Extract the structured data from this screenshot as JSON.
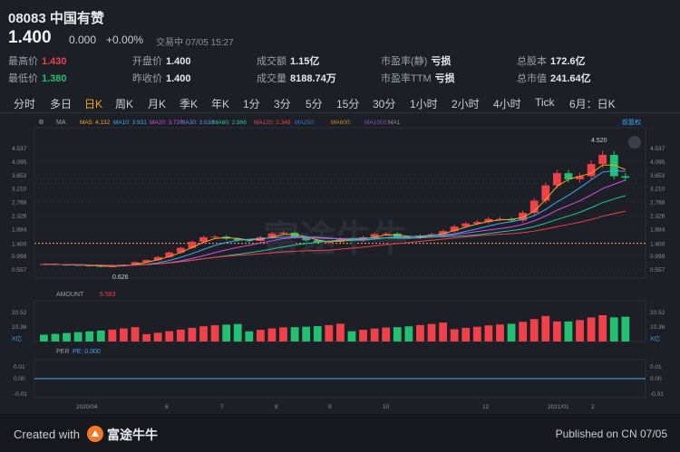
{
  "header": {
    "code_name": "08083 中国有赞",
    "price": "1.400",
    "change": "0.000",
    "change_pct": "+0.00%",
    "status": "交易中 07/05 15:27",
    "stats": [
      {
        "key": "最高价",
        "value": "1.430",
        "tone": "up"
      },
      {
        "key": "开盘价",
        "value": "1.400",
        "tone": ""
      },
      {
        "key": "成交额",
        "value": "1.15亿",
        "tone": ""
      },
      {
        "key": "市盈率(静)",
        "value": "亏损",
        "tone": ""
      },
      {
        "key": "总股本",
        "value": "172.6亿",
        "tone": ""
      },
      {
        "key": "最低价",
        "value": "1.380",
        "tone": "dn"
      },
      {
        "key": "昨收价",
        "value": "1.400",
        "tone": ""
      },
      {
        "key": "成交量",
        "value": "8188.74万",
        "tone": ""
      },
      {
        "key": "市盈率TTM",
        "value": "亏损",
        "tone": ""
      },
      {
        "key": "总市值",
        "value": "241.64亿",
        "tone": ""
      }
    ]
  },
  "tabs": [
    "分时",
    "多日",
    "日K",
    "周K",
    "月K",
    "季K",
    "年K",
    "1分",
    "3分",
    "5分",
    "15分",
    "30分",
    "1小时",
    "2小时",
    "4小时",
    "Tick",
    "6月：日K"
  ],
  "active_tab": "日K",
  "indicators": {
    "ma_label": "MA",
    "ma": [
      {
        "label": "MA5: 4.132",
        "color": "#f5a623"
      },
      {
        "label": "MA10: 3.931",
        "color": "#3fa9f5"
      },
      {
        "label": "MA20: 3.737",
        "color": "#d34fe0"
      },
      {
        "label": "MA30: 3.638",
        "color": "#5b8def"
      },
      {
        "label": "MA60: 2.966",
        "color": "#27c2a0"
      },
      {
        "label": "MA120: 2.348",
        "color": "#f0404a"
      },
      {
        "label": "MA250:",
        "color": "#4a6fd6"
      },
      {
        "label": "MA600:",
        "color": "#c08a2a"
      },
      {
        "label": "MA1000:",
        "color": "#7a52c8"
      },
      {
        "label": "MA1",
        "color": "#8a8f99"
      }
    ],
    "adjust": "前复权",
    "amount_label": "AMOUNT",
    "amount_value": "5.583",
    "per_label": "PER",
    "per_value": "PE: 0.000"
  },
  "chart_data": {
    "type": "candlestick",
    "y_ticks": [
      "4.537",
      "4.095",
      "3.653",
      "3.210",
      "2.768",
      "2.326",
      "1.884",
      "1.400",
      "0.999",
      "0.557"
    ],
    "y_ticks_right": [
      "4.537",
      "4.095",
      "3.653",
      "3.210",
      "2.768",
      "2.326",
      "1.884",
      "1.400",
      "0.999",
      "0.557"
    ],
    "current_price": "1.400",
    "high_label": "4.520",
    "low_label": "0.626",
    "amount_ticks": [
      "20.52",
      "10.36"
    ],
    "amount_unit": "X亿",
    "per_ticks": [
      "0.01",
      "0.00",
      "-0.01"
    ],
    "x_labels": [
      "2020/04",
      "6",
      "7",
      "8",
      "9",
      "10",
      "12",
      "2021/01",
      "2"
    ],
    "close_series": [
      0.72,
      0.7,
      0.69,
      0.68,
      0.66,
      0.63,
      0.65,
      0.7,
      0.78,
      0.85,
      0.95,
      1.1,
      1.25,
      1.45,
      1.6,
      1.62,
      1.55,
      1.5,
      1.48,
      1.6,
      1.72,
      1.75,
      1.6,
      1.5,
      1.42,
      1.45,
      1.55,
      1.5,
      1.6,
      1.7,
      1.72,
      1.6,
      1.58,
      1.65,
      1.7,
      1.8,
      1.95,
      2.05,
      2.1,
      2.2,
      2.2,
      2.15,
      2.4,
      2.8,
      3.3,
      3.7,
      3.5,
      3.6,
      4.0,
      4.3,
      3.6,
      3.55
    ]
  },
  "footer": {
    "created": "Created with",
    "brand": "富途牛牛",
    "published": "Published on CN 07/05"
  },
  "colors": {
    "up": "#f0404a",
    "down": "#22c070",
    "accent": "#f5a623",
    "bg": "#1c1f26"
  }
}
